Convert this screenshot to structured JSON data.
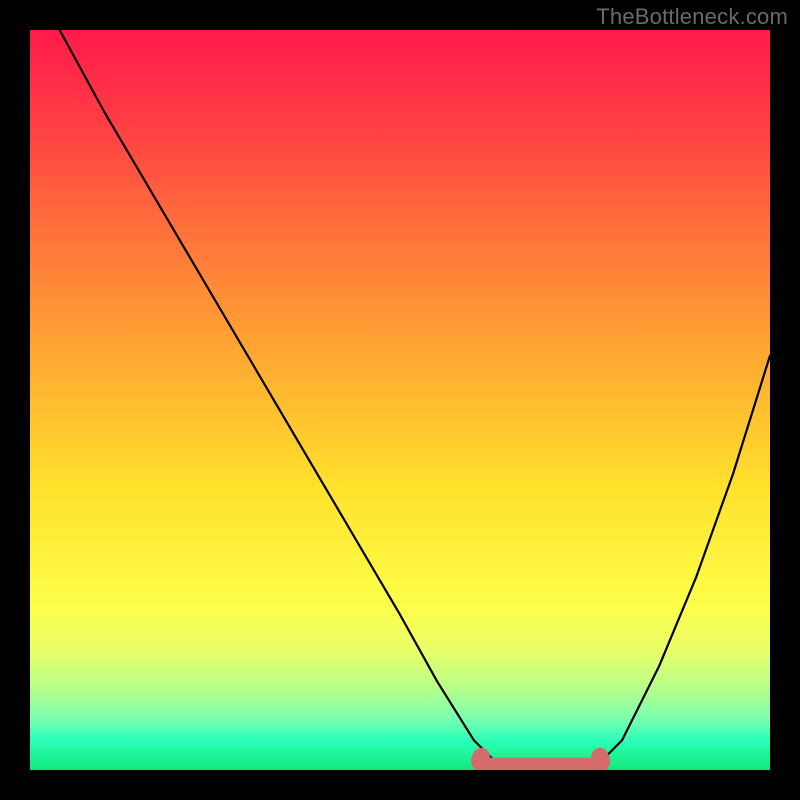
{
  "watermark": "TheBottleneck.com",
  "chart_data": {
    "type": "line",
    "title": "",
    "xlabel": "",
    "ylabel": "",
    "xlim": [
      0,
      100
    ],
    "ylim": [
      0,
      100
    ],
    "grid": false,
    "series": [
      {
        "name": "curve",
        "color": "#000000",
        "x": [
          4,
          10,
          20,
          30,
          40,
          50,
          55,
          60,
          63,
          66,
          70,
          74,
          77,
          80,
          85,
          90,
          95,
          100
        ],
        "values": [
          100,
          89,
          72,
          55,
          38,
          21,
          12,
          4,
          1,
          0,
          0,
          0,
          1,
          4,
          14,
          26,
          40,
          56
        ]
      }
    ],
    "highlight_region": {
      "name": "optimal-zone",
      "color": "#d46a6a",
      "x_start": 61,
      "x_end": 77,
      "y": 0.5
    },
    "background_gradient": {
      "top": "#ff1a4a",
      "mid": "#ffe22c",
      "bottom": "#11e87a"
    }
  }
}
